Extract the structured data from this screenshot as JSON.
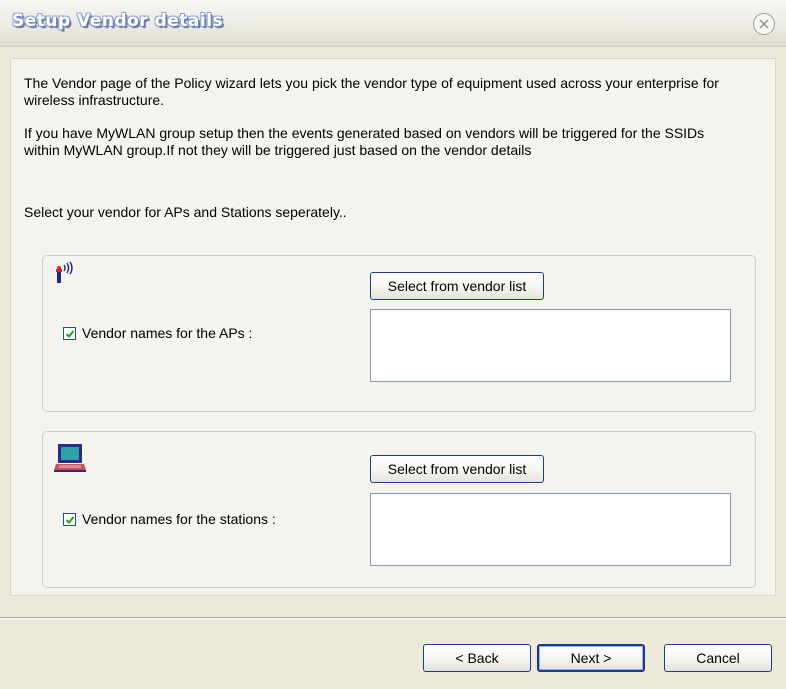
{
  "dialog": {
    "title": "Setup Vendor details",
    "close_icon": "close-circle-icon"
  },
  "intro": {
    "paragraph1": "The Vendor page of the Policy wizard lets you pick the vendor type of equipment used across your enterprise for wireless infrastructure.",
    "paragraph2": "If you have MyWLAN group setup then the events generated based on vendors will be triggered for the SSIDs within MyWLAN group.If not they will be triggered just based on the vendor details",
    "paragraph3": "Select your vendor for APs and Stations seperately.."
  },
  "aps_group": {
    "icon": "wireless-ap-icon",
    "select_button": "Select from vendor list",
    "checkbox_label": "Vendor names for the  APs :",
    "checked": true,
    "vendor_names": ""
  },
  "stations_group": {
    "icon": "laptop-icon",
    "select_button": "Select from vendor list",
    "checkbox_label": "Vendor names for the stations :",
    "checked": true,
    "vendor_names": ""
  },
  "footer": {
    "back_label": "< Back",
    "next_label": "Next >",
    "cancel_label": "Cancel"
  },
  "colors": {
    "window_bg": "#ece9d8",
    "button_border": "#1e3a8c",
    "checkmark": "#21a121"
  }
}
